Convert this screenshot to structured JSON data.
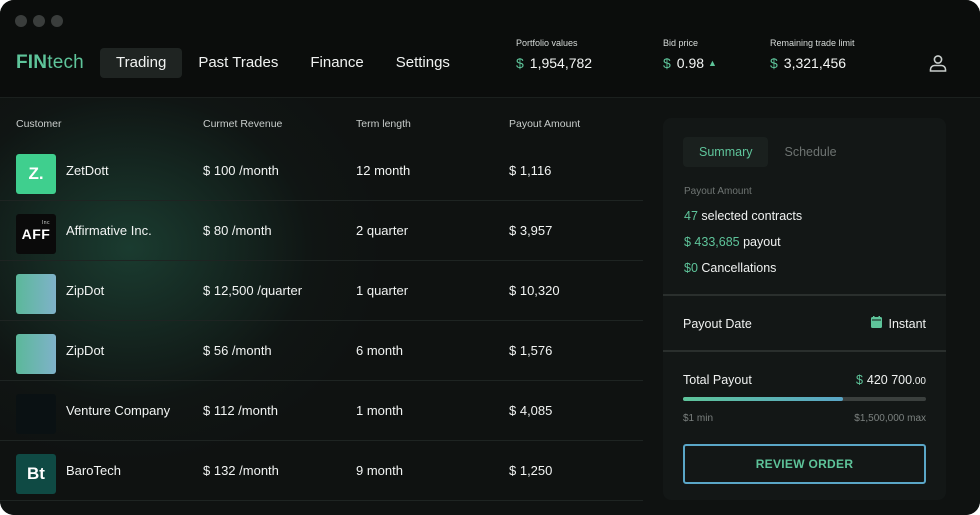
{
  "app": {
    "logo_bold": "FIN",
    "logo_rest": "tech"
  },
  "nav": [
    {
      "label": "Trading",
      "active": true
    },
    {
      "label": "Past Trades"
    },
    {
      "label": "Finance"
    },
    {
      "label": "Settings"
    }
  ],
  "stats": {
    "portfolio": {
      "label": "Portfolio values",
      "currency": "$",
      "value": "1,954,782"
    },
    "bid": {
      "label": "Bid price",
      "currency": "$",
      "value": "0.98",
      "trend": "▲"
    },
    "limit": {
      "label": "Remaining trade limit",
      "currency": "$",
      "value": "3,321,456"
    }
  },
  "table": {
    "headers": [
      "Customer",
      "Curmet Revenue",
      "Term length",
      "Payout Amount"
    ],
    "rows": [
      {
        "avatar_text": "Z.",
        "avatar_style": "z",
        "name": "ZetDott",
        "revenue": "$ 100 /month",
        "term": "12 month",
        "payout": "$ 1,116"
      },
      {
        "avatar_text": "AFF",
        "avatar_small": "Inc",
        "avatar_style": "aff",
        "name": "Affirmative Inc.",
        "revenue": "$ 80 /month",
        "term": "2 quarter",
        "payout": "$ 3,957"
      },
      {
        "avatar_text": "",
        "avatar_style": "grad",
        "name": "ZipDot",
        "revenue": "$ 12,500 /quarter",
        "term": "1 quarter",
        "payout": "$ 10,320"
      },
      {
        "avatar_text": "",
        "avatar_style": "grad",
        "name": "ZipDot",
        "revenue": "$ 56 /month",
        "term": "6 month",
        "payout": "$ 1,576"
      },
      {
        "avatar_text": "",
        "avatar_style": "dark",
        "name": "Venture Company",
        "revenue": "$ 112 /month",
        "term": "1 month",
        "payout": "$ 4,085"
      },
      {
        "avatar_text": "Bt",
        "avatar_style": "bt",
        "name": "BaroTech",
        "revenue": "$ 132 /month",
        "term": "9 month",
        "payout": "$ 1,250"
      }
    ]
  },
  "summary": {
    "tabs": [
      {
        "label": "Summary",
        "active": true
      },
      {
        "label": "Schedule"
      }
    ],
    "payout_label": "Payout Amount",
    "contracts_count": "47",
    "contracts_text": " selected contracts",
    "payout_value": "$ 433,685",
    "payout_text": " payout",
    "cancel_value": "$0",
    "cancel_text": " Cancellations",
    "payout_date_label": "Payout Date",
    "payout_date_value": "Instant",
    "total_label": "Total Payout",
    "total_currency": "$",
    "total_value": "420 700",
    "total_cents": ".00",
    "slider_fraction": 0.66,
    "min_label": "$1 min",
    "max_label": "$1,500,000 max",
    "review_button": "REVIEW ORDER"
  },
  "colors": {
    "accent": "#5ec49a",
    "accent_blue": "#5aa6c7"
  }
}
